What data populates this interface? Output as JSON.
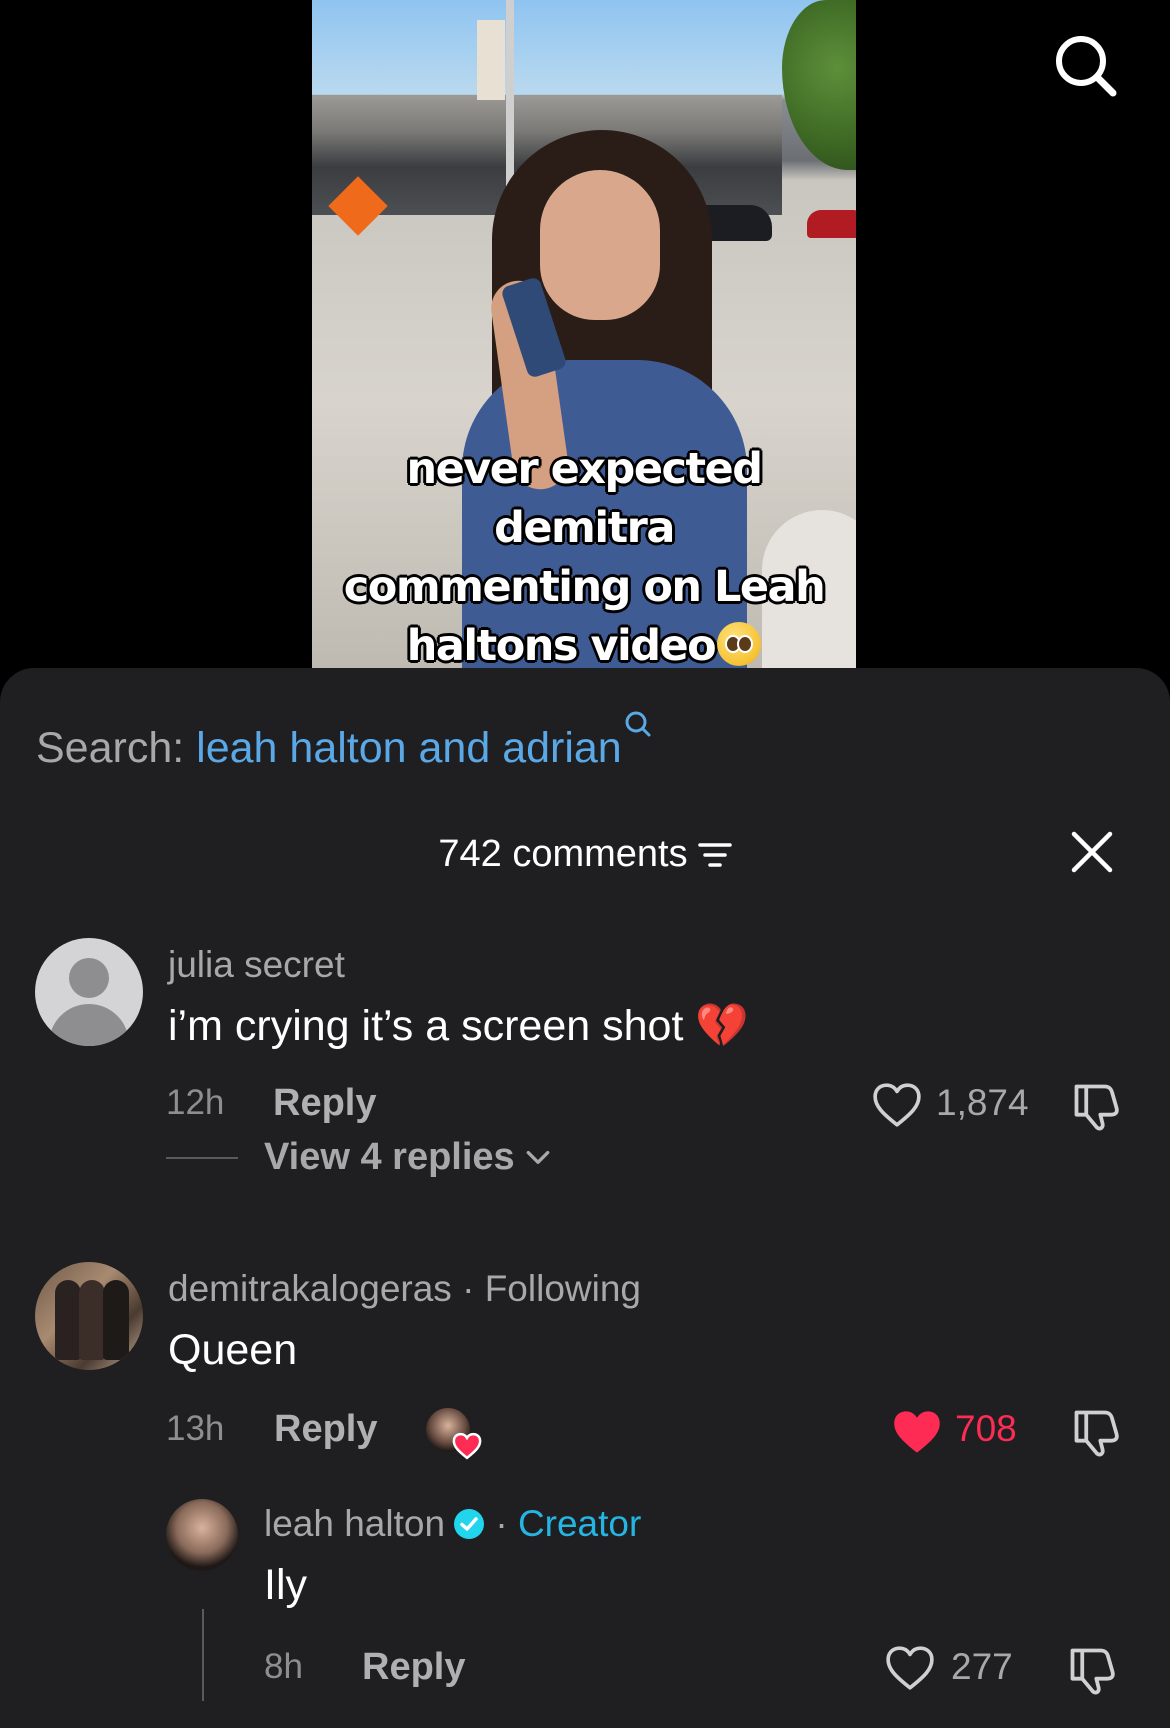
{
  "video": {
    "caption_line1": "never expected demitra",
    "caption_line2": "commenting on Leah",
    "caption_line3": "haltons video",
    "caption_emoji": "pleading-face-emoji"
  },
  "search": {
    "label": "Search:",
    "query": "leah halton and adrian"
  },
  "comments_header": {
    "title": "742 comments"
  },
  "comments": [
    {
      "username": "julia secret",
      "text": "i’m crying it’s a screen shot 💔",
      "time": "12h",
      "reply_label": "Reply",
      "likes": "1,874",
      "liked": false,
      "view_replies": "View 4 replies"
    },
    {
      "username": "demitrakalogeras",
      "separator": "·",
      "tag": "Following",
      "text": "Queen",
      "time": "13h",
      "reply_label": "Reply",
      "likes": "708",
      "liked": true
    }
  ],
  "reply": {
    "username": "leah halton",
    "separator": "·",
    "tag": "Creator",
    "text": "Ily",
    "time": "8h",
    "reply_label": "Reply",
    "likes": "277"
  },
  "colors": {
    "sheet_bg": "#1f1f21",
    "search_query": "#5aa8e6",
    "creator_tag": "#25b5e3",
    "like_red": "#fe2c55",
    "muted_text": "#a8a8aa"
  }
}
